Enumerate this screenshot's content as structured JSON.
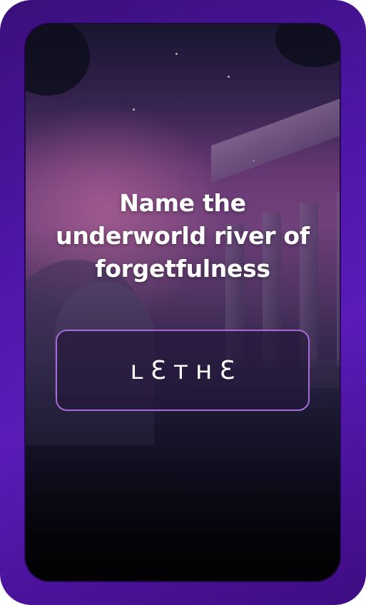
{
  "quiz": {
    "question": "Name the underworld river of forgetfulness",
    "answer_display": "ʟƐᴛʜƐ",
    "answer_text": "LETHE"
  },
  "colors": {
    "frame": "#4d16a6",
    "answer_border": "#a56bd8",
    "text": "#ffffff"
  }
}
